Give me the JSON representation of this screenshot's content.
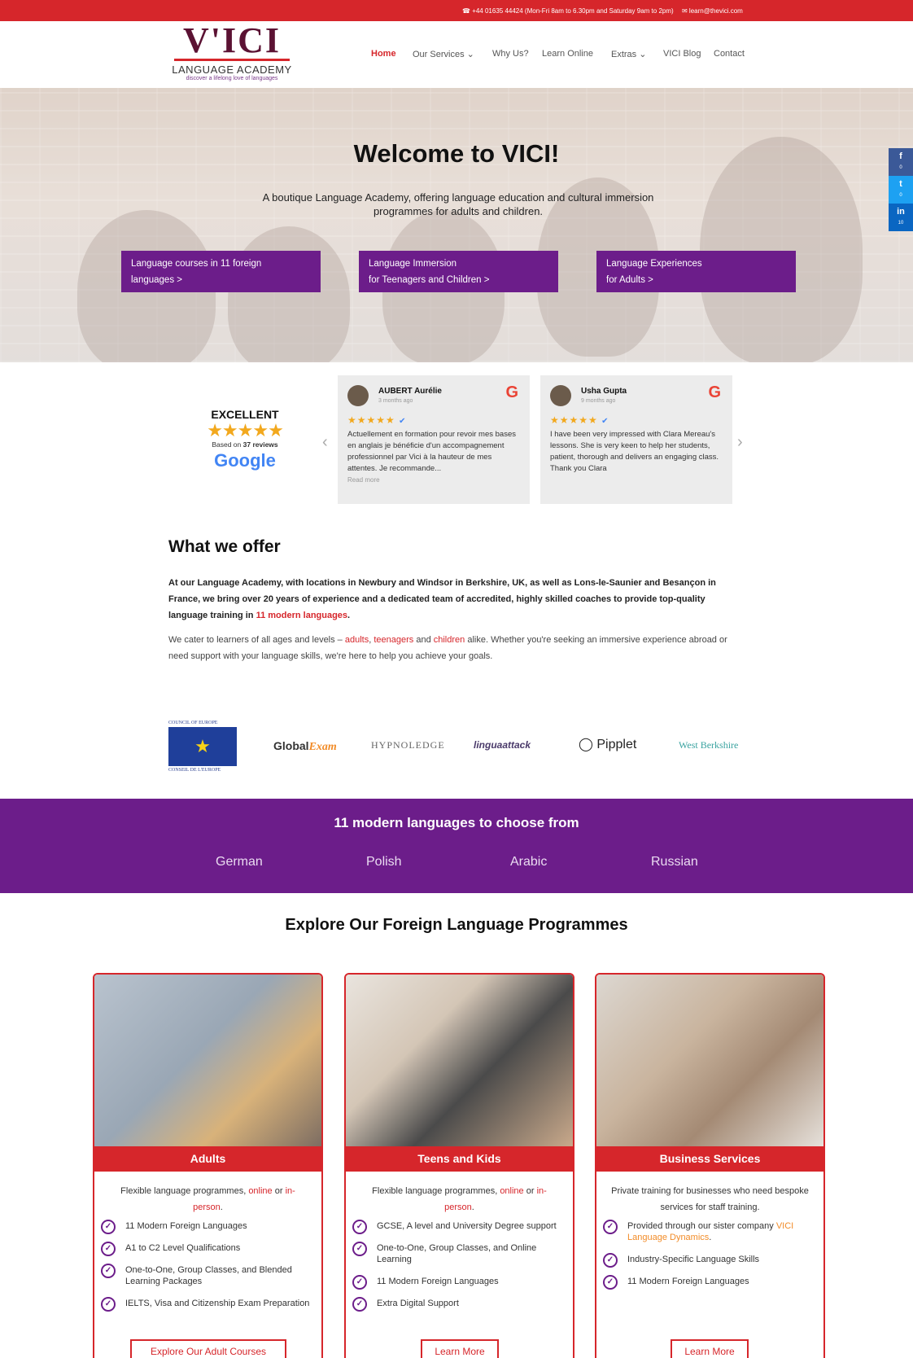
{
  "topbar": {
    "phone": "☎ +44 01635 44424 (Mon-Fri 8am to 6.30pm and Saturday 9am to 2pm)",
    "email": "✉ learn@thevici.com"
  },
  "logo": {
    "mark": "V'ICI",
    "name": "LANGUAGE ACADEMY",
    "tagline": "discover a lifelong love of languages"
  },
  "nav": {
    "home": "Home",
    "services": "Our Services ⌄",
    "why": "Why Us?",
    "learn_online": "Learn Online",
    "extras": "Extras ⌄",
    "blog": "VICI Blog",
    "contact": "Contact"
  },
  "hero": {
    "title": "Welcome to VICI!",
    "subtitle": "A boutique Language Academy, offering language education and cultural immersion programmes for adults and children.",
    "cta1_line1": "Language courses in 11 foreign",
    "cta1_line2": "languages  >",
    "cta2_line1": "Language Immersion",
    "cta2_line2": "for Teenagers and Children  >",
    "cta3_line1": "Language Experiences",
    "cta3_line2": "for Adults  >"
  },
  "social": {
    "facebook": "f",
    "facebook_count": "0",
    "twitter": "t",
    "twitter_count": "0",
    "linkedin": "in",
    "linkedin_count": "10",
    "colors": {
      "facebook": "#3b5998",
      "twitter": "#1da1f2",
      "linkedin": "#0a66c2"
    }
  },
  "rating": {
    "label": "EXCELLENT",
    "stars": "★★★★★",
    "based_prefix": "Based on",
    "count": "37 reviews",
    "brand": "Google"
  },
  "reviews": [
    {
      "name": "AUBERT Aurélie",
      "ago": "3 months ago",
      "stars": "★★★★★",
      "text": "Actuellement en formation pour revoir mes bases en anglais je bénéficie d'un accompagnement professionnel par Vici à la hauteur de mes attentes. Je recommande...",
      "more": "Read more"
    },
    {
      "name": "Usha Gupta",
      "ago": "9 months ago",
      "stars": "★★★★★",
      "text": "I have been very impressed with Clara Mereau's lessons. She is very keen to help her students, patient, thorough and delivers an engaging class. Thank you Clara",
      "more": ""
    }
  ],
  "offer": {
    "title": "What we offer",
    "p1_a": "At our Language Academy, with locations in Newbury and Windsor in Berkshire, UK, as well as Lons-le-Saunier and Besançon in France, we bring over 20 years of experience and a dedicated team of accredited, highly skilled coaches to provide top-quality language training in ",
    "p1_link": "11 modern languages",
    "p1_end": ".",
    "p2_a": "We cater to learners of all ages and levels – ",
    "p2_adults": "adults",
    "p2_comma": ", ",
    "p2_teen": "teenagers",
    "p2_and": " and ",
    "p2_children": "children",
    "p2_b": " alike. Whether you're seeking an immersive experience abroad or need support with your language skills, we're here to help you achieve your goals."
  },
  "partners": {
    "coe_top": "COUNCIL OF EUROPE",
    "coe_bottom": "CONSEIL DE L'EUROPE",
    "global_a": "Global",
    "global_b": "Exam",
    "hypno": "HYPNOLEDGE",
    "lingua": "linguaattack",
    "pipplet": "Pipplet",
    "westberks": "West Berkshire"
  },
  "languages": {
    "title": "11 modern languages to choose from",
    "items": [
      "German",
      "Polish",
      "Arabic",
      "Russian"
    ]
  },
  "explore": {
    "title": "Explore Our Foreign Language Programmes"
  },
  "cards": [
    {
      "title": "Adults",
      "desc_a": "Flexible language programmes, ",
      "desc_online": "online",
      "desc_or": " or ",
      "desc_inperson": "in-person",
      "desc_end": ".",
      "items": [
        "11 Modern Foreign Languages",
        "A1 to C2 Level Qualifications",
        "One-to-One, Group Classes, and Blended Learning Packages",
        "IELTS, Visa and Citizenship Exam Preparation"
      ],
      "button": "Explore Our Adult Courses"
    },
    {
      "title": "Teens and Kids",
      "desc_a": "Flexible language programmes, ",
      "desc_online": "online",
      "desc_or": " or ",
      "desc_inperson": "in-person",
      "desc_end": ".",
      "items": [
        "GCSE, A level and University Degree support",
        "One-to-One, Group Classes, and Online Learning",
        "11 Modern Foreign Languages",
        "Extra Digital Support"
      ],
      "button": "Learn More"
    },
    {
      "title": "Business Services",
      "desc_a": "Private training for businesses who need bespoke services for staff training.",
      "items_first_a": "Provided through our sister company ",
      "items_first_link": "VICI Language Dynamics",
      "items_first_end": ".",
      "items": [
        "Industry-Specific Language Skills",
        "11 Modern Foreign Languages"
      ],
      "button": "Learn More"
    }
  ],
  "colors": {
    "brand_red": "#d6262b",
    "brand_purple": "#6c1d8a"
  }
}
